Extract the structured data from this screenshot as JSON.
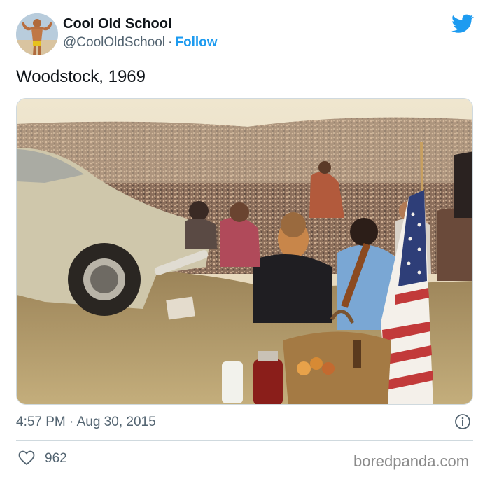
{
  "author": {
    "name": "Cool Old School",
    "handle": "@CoolOldSchool",
    "separator": "·",
    "follow_label": "Follow",
    "avatar": "bodybuilder-avatar-icon"
  },
  "tweet": {
    "text": "Woodstock, 1969",
    "timestamp": "4:57 PM · Aug 30, 2015",
    "likes": "962",
    "media": "woodstock-festival-crowd-photo"
  },
  "icons": {
    "brand": "twitter-bird-icon",
    "info": "info-icon",
    "like": "heart-icon"
  },
  "colors": {
    "accent": "#1d9bf0",
    "secondary_text": "#536471",
    "divider": "#cfd9de"
  },
  "watermark": "boredpanda.com"
}
